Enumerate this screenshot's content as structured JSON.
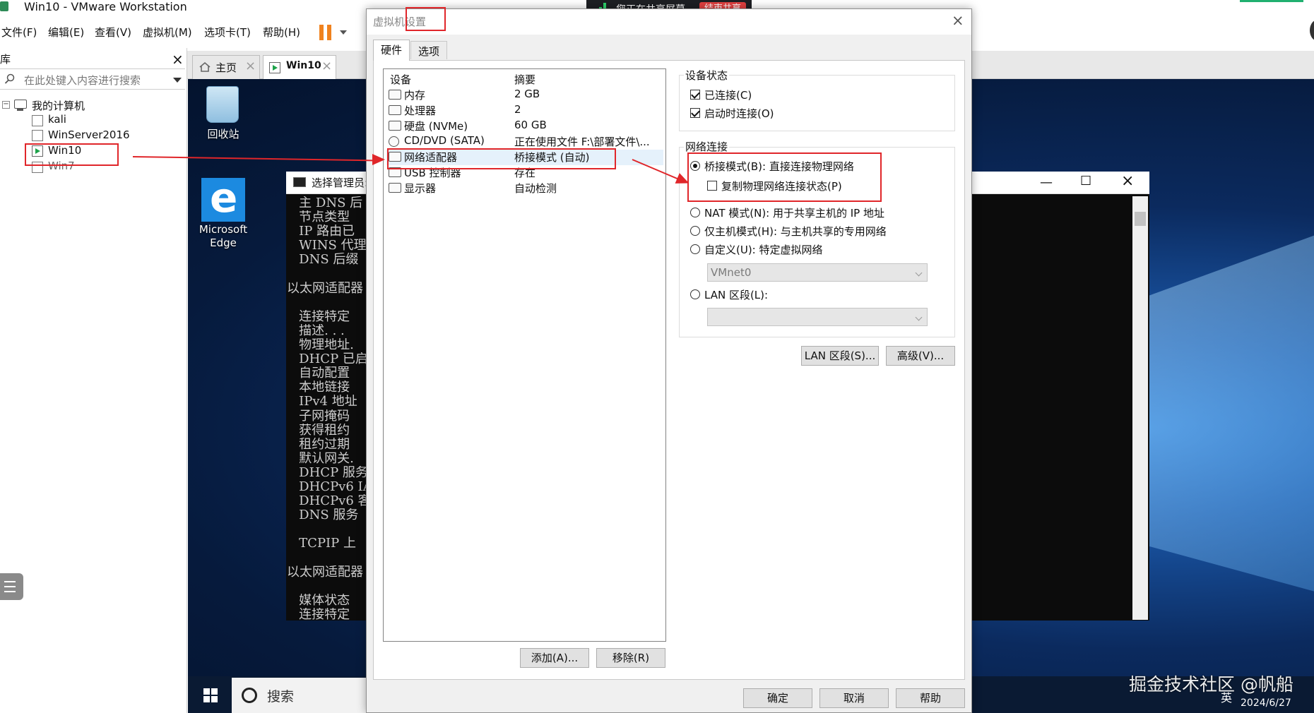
{
  "window": {
    "title": "Win10 - VMware Workstation"
  },
  "menu": [
    "文件(F)",
    "编辑(E)",
    "查看(V)",
    "虚拟机(M)",
    "选项卡(T)",
    "帮助(H)"
  ],
  "sidebar": {
    "header_char": "库",
    "search_placeholder": "在此处键入内容进行搜索",
    "root": "我的计算机",
    "items": [
      "kali",
      "WinServer2016",
      "Win10",
      "Win7"
    ]
  },
  "tabs": [
    {
      "label": "主页"
    },
    {
      "label": "Win10"
    }
  ],
  "desktop": {
    "icons": [
      {
        "label": "回收站"
      },
      {
        "label": "Microsoft Edge"
      }
    ]
  },
  "cmd": {
    "title": "选择管理员:",
    "lines": [
      "   主 DNS 后",
      "   节点类型",
      "   IP 路由已",
      "   WINS 代理",
      "   DNS 后缀",
      "",
      "以太网适配器",
      "",
      "   连接特定",
      "   描述. . .",
      "   物理地址.",
      "   DHCP 已启",
      "   自动配置",
      "   本地链接",
      "   IPv4 地址",
      "   子网掩码",
      "   获得租约",
      "   租约过期",
      "   默认网关.",
      "   DHCP 服务",
      "   DHCPv6 IA",
      "   DHCPv6 客",
      "   DNS 服务",
      "",
      "   TCPIP 上",
      "",
      "以太网适配器",
      "",
      "   媒体状态",
      "   连接特定"
    ]
  },
  "taskbar": {
    "search_label": "搜索",
    "ime": "英",
    "date": "2024/6/27"
  },
  "watermark": "掘金技术社区 @帆船",
  "share_banner": {
    "text": "您正在共享屏幕",
    "stop": "结束共享"
  },
  "dialog": {
    "title": "虚拟机设置",
    "tabs": [
      "硬件",
      "选项"
    ],
    "device_col": "设备",
    "summary_col": "摘要",
    "devices": [
      {
        "name": "内存",
        "summary": "2 GB"
      },
      {
        "name": "处理器",
        "summary": "2"
      },
      {
        "name": "硬盘 (NVMe)",
        "summary": "60 GB"
      },
      {
        "name": "CD/DVD (SATA)",
        "summary": "正在使用文件 F:\\部署文件\\..."
      },
      {
        "name": "网络适配器",
        "summary": "桥接模式 (自动)"
      },
      {
        "name": "USB 控制器",
        "summary": "存在"
      },
      {
        "name": "显示器",
        "summary": "自动检测"
      }
    ],
    "add_button": "添加(A)...",
    "remove_button": "移除(R)",
    "device_status": {
      "title": "设备状态",
      "connected": "已连接(C)",
      "connect_on_power": "启动时连接(O)"
    },
    "network": {
      "title": "网络连接",
      "bridged": "桥接模式(B): 直接连接物理网络",
      "replicate": "复制物理网络连接状态(P)",
      "nat": "NAT 模式(N): 用于共享主机的 IP 地址",
      "host_only": "仅主机模式(H): 与主机共享的专用网络",
      "custom": "自定义(U): 特定虚拟网络",
      "custom_value": "VMnet0",
      "lan": "LAN 区段(L):",
      "lan_value": ""
    },
    "lan_segments_button": "LAN 区段(S)...",
    "advanced_button": "高级(V)...",
    "ok_button": "确定",
    "cancel_button": "取消",
    "help_button": "帮助"
  }
}
